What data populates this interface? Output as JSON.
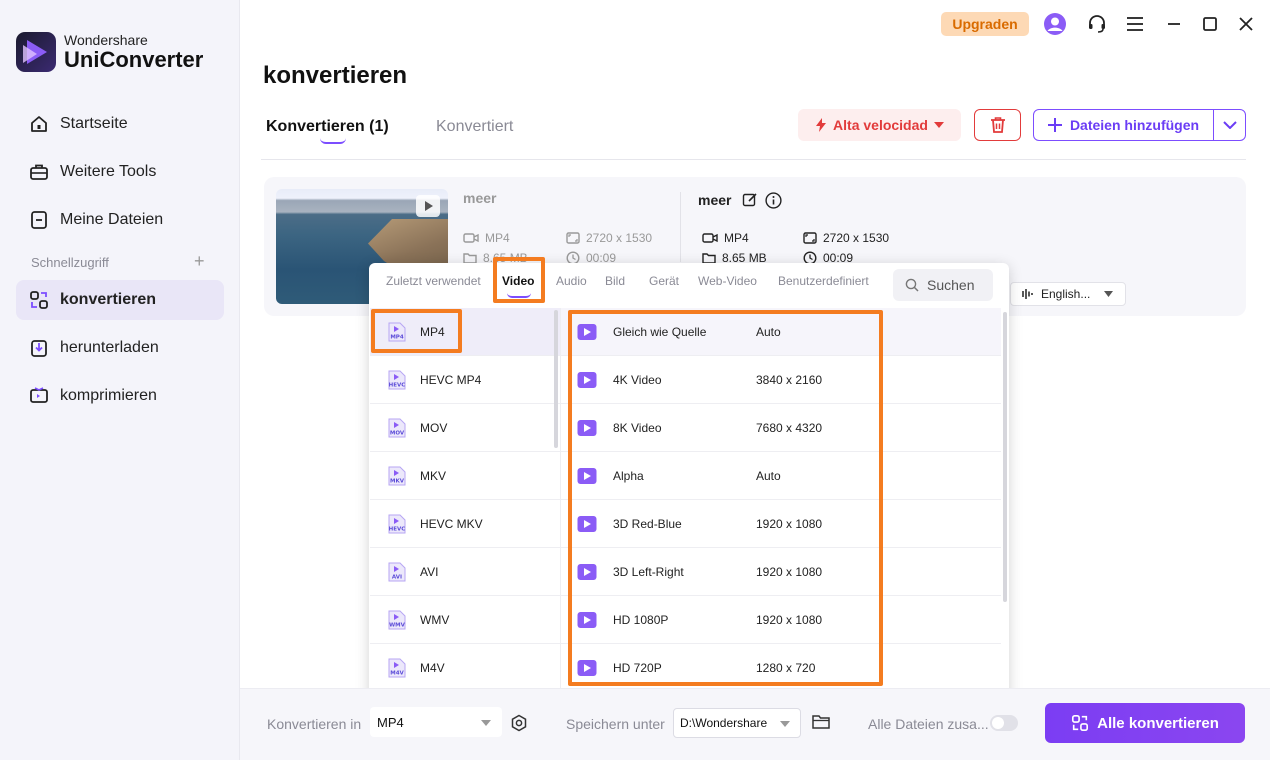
{
  "app": {
    "brand": "Wondershare",
    "product": "UniConverter"
  },
  "header": {
    "upgrade_label": "Upgraden",
    "page_title": "konvertieren"
  },
  "sidebar": {
    "items": [
      {
        "label": "Startseite",
        "icon": "home-icon"
      },
      {
        "label": "Weitere Tools",
        "icon": "toolbox-icon"
      },
      {
        "label": "Meine Dateien",
        "icon": "file-icon"
      }
    ],
    "section_label": "Schnellzugriff",
    "quick": [
      {
        "label": "konvertieren",
        "icon": "convert-icon",
        "active": true
      },
      {
        "label": "herunterladen",
        "icon": "download-icon"
      },
      {
        "label": "komprimieren",
        "icon": "compress-icon"
      }
    ]
  },
  "tabs": {
    "active": "Konvertieren (1)",
    "inactive": "Konvertiert"
  },
  "toolbar": {
    "speed_label": "Alta velocidad",
    "add_files_label": "Dateien hinzufügen"
  },
  "file": {
    "source": {
      "name": "meer",
      "format": "MP4",
      "resolution": "2720 x 1530",
      "size": "8.65 MB",
      "duration": "00:09"
    },
    "target": {
      "name": "meer",
      "format": "MP4",
      "resolution": "2720 x 1530",
      "size": "8.65 MB",
      "duration": "00:09"
    },
    "audio_language": "English..."
  },
  "format_panel": {
    "tabs": [
      "Zuletzt verwendet",
      "Video",
      "Audio",
      "Bild",
      "Gerät",
      "Web-Video",
      "Benutzerdefiniert"
    ],
    "active_tab": "Video",
    "search_placeholder": "Suchen",
    "formats": [
      {
        "label": "MP4",
        "badge": "MP4"
      },
      {
        "label": "HEVC MP4",
        "badge": "HEVC"
      },
      {
        "label": "MOV",
        "badge": "MOV"
      },
      {
        "label": "MKV",
        "badge": "MKV"
      },
      {
        "label": "HEVC MKV",
        "badge": "HEVC"
      },
      {
        "label": "AVI",
        "badge": "AVI"
      },
      {
        "label": "WMV",
        "badge": "WMV"
      },
      {
        "label": "M4V",
        "badge": "M4V"
      }
    ],
    "resolutions": [
      {
        "name": "Gleich wie Quelle",
        "value": "Auto"
      },
      {
        "name": "4K Video",
        "value": "3840 x 2160"
      },
      {
        "name": "8K Video",
        "value": "7680 x 4320"
      },
      {
        "name": "Alpha",
        "value": "Auto"
      },
      {
        "name": "3D Red-Blue",
        "value": "1920 x 1080"
      },
      {
        "name": "3D Left-Right",
        "value": "1920 x 1080"
      },
      {
        "name": "HD 1080P",
        "value": "1920 x 1080"
      },
      {
        "name": "HD 720P",
        "value": "1280 x 720"
      }
    ]
  },
  "bottom": {
    "convert_in_label": "Konvertieren in",
    "convert_in_value": "MP4",
    "save_label": "Speichern unter",
    "save_path": "D:\\Wondershare",
    "merge_label": "Alle Dateien zusa...",
    "convert_all_label": "Alle konvertieren"
  },
  "colors": {
    "accent": "#7c3aed",
    "highlight": "#f47c20",
    "danger": "#e23b3b",
    "upgrade_bg": "#fdd9b5"
  }
}
